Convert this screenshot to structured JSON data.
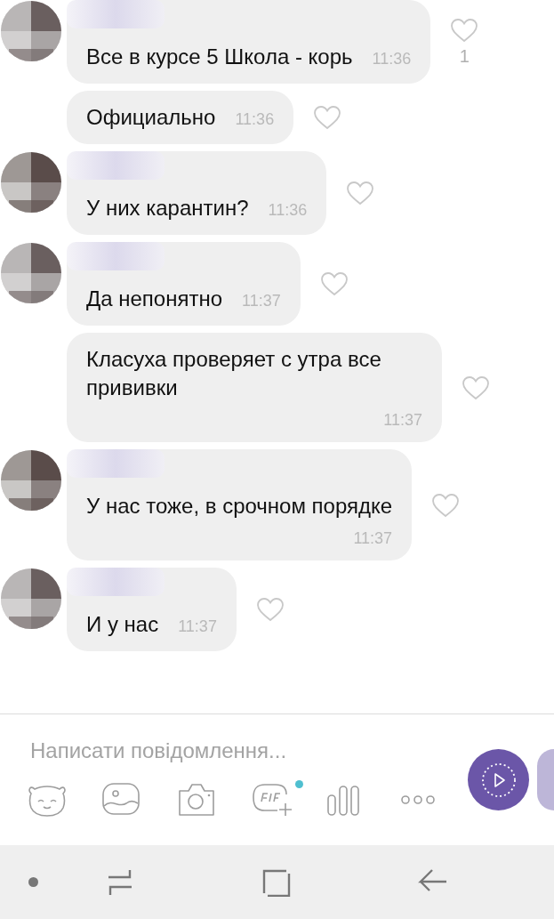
{
  "messages": [
    {
      "show_sender": true,
      "text": "Все в курсе 5 Школа - корь",
      "time": "11:36",
      "kind": "inline",
      "liked": false,
      "likes": "1"
    },
    {
      "show_sender": false,
      "text": "Официально",
      "time": "11:36",
      "kind": "inline",
      "liked": false
    },
    {
      "show_sender": true,
      "text": "У них карантин?",
      "time": "11:36",
      "kind": "inline",
      "liked": false
    },
    {
      "show_sender": true,
      "text": "Да непонятно",
      "time": "11:37",
      "kind": "inline",
      "liked": false
    },
    {
      "show_sender": false,
      "text": "Класуха проверяет с утра все прививки",
      "time": "11:37",
      "kind": "wrapped",
      "liked": false
    },
    {
      "show_sender": true,
      "text": "У нас тоже, в срочном порядке",
      "time": "11:37",
      "kind": "wrapped",
      "liked": false
    },
    {
      "show_sender": true,
      "text": "И у нас",
      "time": "11:37",
      "kind": "inline",
      "liked": false
    }
  ],
  "composer": {
    "placeholder": "Написати повідомлення...",
    "gif_badge": true
  }
}
